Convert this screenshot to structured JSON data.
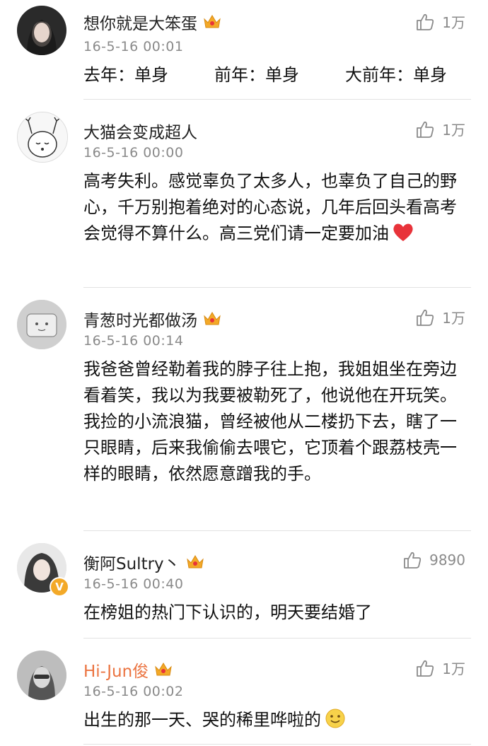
{
  "comments": [
    {
      "username": "想你就是大笨蛋",
      "time": "16-5-16 00:01",
      "likes": "1万",
      "text_parts": [
        "去年：单身",
        "前年：单身",
        "大前年：单身"
      ],
      "vip": true,
      "verified": false
    },
    {
      "username": "大猫会变成超人",
      "time": "16-5-16 00:00",
      "likes": "1万",
      "text": "高考失利。感觉辜负了太多人，也辜负了自己的野心，千万别抱着绝对的心态说，几年后回头看高考会觉得不算什么。高三党们请一定要加油",
      "vip": false,
      "verified": false,
      "emoji": "heart"
    },
    {
      "username": "青葱时光都做汤",
      "time": "16-5-16 00:14",
      "likes": "1万",
      "text": "我爸爸曾经勒着我的脖子往上抱，我姐姐坐在旁边看着笑，我以为我要被勒死了，他说他在开玩笑。我捡的小流浪猫，曾经被他从二楼扔下去，瞎了一只眼睛，后来我偷偷去喂它，它顶着个跟荔枝壳一样的眼睛，依然愿意蹭我的手。",
      "vip": true,
      "verified": false
    },
    {
      "username": "衡阿Sultry丶",
      "time": "16-5-16 00:40",
      "likes": "9890",
      "text": "在榜姐的热门下认识的，明天要结婚了",
      "vip": true,
      "verified": true,
      "verified_mark": "V"
    },
    {
      "username": "Hi-Jun俊",
      "time": "16-5-16 00:02",
      "likes": "1万",
      "text": "出生的那一天、哭的稀里哗啦的",
      "vip": true,
      "verified": false,
      "emoji": "smile"
    }
  ],
  "icons": {
    "like": "thumbs-up-icon",
    "vip": "crown-icon",
    "heart": "heart-emoji-icon",
    "smile": "smile-emoji-icon",
    "verified": "verified-badge-icon"
  },
  "colors": {
    "vip_name": "#eb7340",
    "crown": "#f3a928",
    "heart": "#e8333a",
    "meta": "#8a8a8a"
  }
}
